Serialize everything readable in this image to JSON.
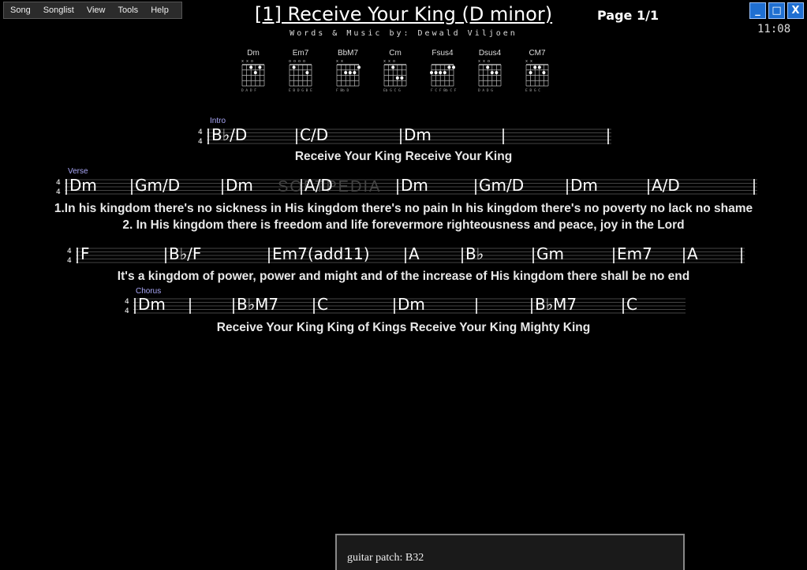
{
  "menu": [
    "Song",
    "Songlist",
    "View",
    "Tools",
    "Help"
  ],
  "song": {
    "title": "[1] Receive Your King (D minor)",
    "credits": "Words & Music by: Dewald Viljoen",
    "page": "Page 1/1"
  },
  "clock": "11:08",
  "window_controls": {
    "minimize": "_",
    "maximize": "□",
    "close": "X"
  },
  "chord_diagrams": [
    {
      "name": "Dm",
      "top": "x x o",
      "bottom": "D A D F"
    },
    {
      "name": "Em7",
      "top": "o o o o",
      "bottom": "E B D G B E"
    },
    {
      "name": "BbM7",
      "top": "x x",
      "bottom": "F Bb D"
    },
    {
      "name": "Cm",
      "top": "x x   o",
      "bottom": "Eb G C G"
    },
    {
      "name": "Fsus4",
      "top": "",
      "bottom": "F C F Bb C F"
    },
    {
      "name": "Dsus4",
      "top": "x x o",
      "bottom": "D A D G"
    },
    {
      "name": "CM7",
      "top": "x x",
      "bottom": "E B G C"
    }
  ],
  "sections": {
    "intro": "Intro",
    "verse": "Verse",
    "chorus": "Chorus"
  },
  "time_signature": {
    "top": "4",
    "bottom": "4"
  },
  "lyrics": {
    "intro": "Receive Your King Receive Your King",
    "verse1": "1.In his kingdom there's no sickness in His kingdom there's no pain In his kingdom there's no poverty no lack no shame",
    "verse2": "2. In His kingdom there is freedom and life forevermore righteousness and peace, joy in the Lord",
    "bridge": "It's a kingdom of power, power and  might and of the increase of His kingdom there shall be no end",
    "chorus": "Receive Your King  King of Kings  Receive Your King  Mighty King"
  },
  "chords": {
    "intro": [
      "B♭/D",
      "C/D",
      "Dm",
      ""
    ],
    "verse": [
      "Dm",
      "Gm/D",
      "Dm",
      "A/D",
      "Dm",
      "Gm/D",
      "Dm",
      "A/D"
    ],
    "bridge": [
      "F",
      "B♭/F",
      "Em7(add11)",
      "A",
      "B♭",
      "Gm",
      "Em7",
      "A"
    ],
    "chorus": [
      "Dm",
      "",
      "B♭M7",
      "C",
      "Dm",
      "",
      "B♭M7",
      "C"
    ]
  },
  "watermark": "SOFTPEDIA",
  "status": {
    "patch": "guitar patch: B32"
  }
}
